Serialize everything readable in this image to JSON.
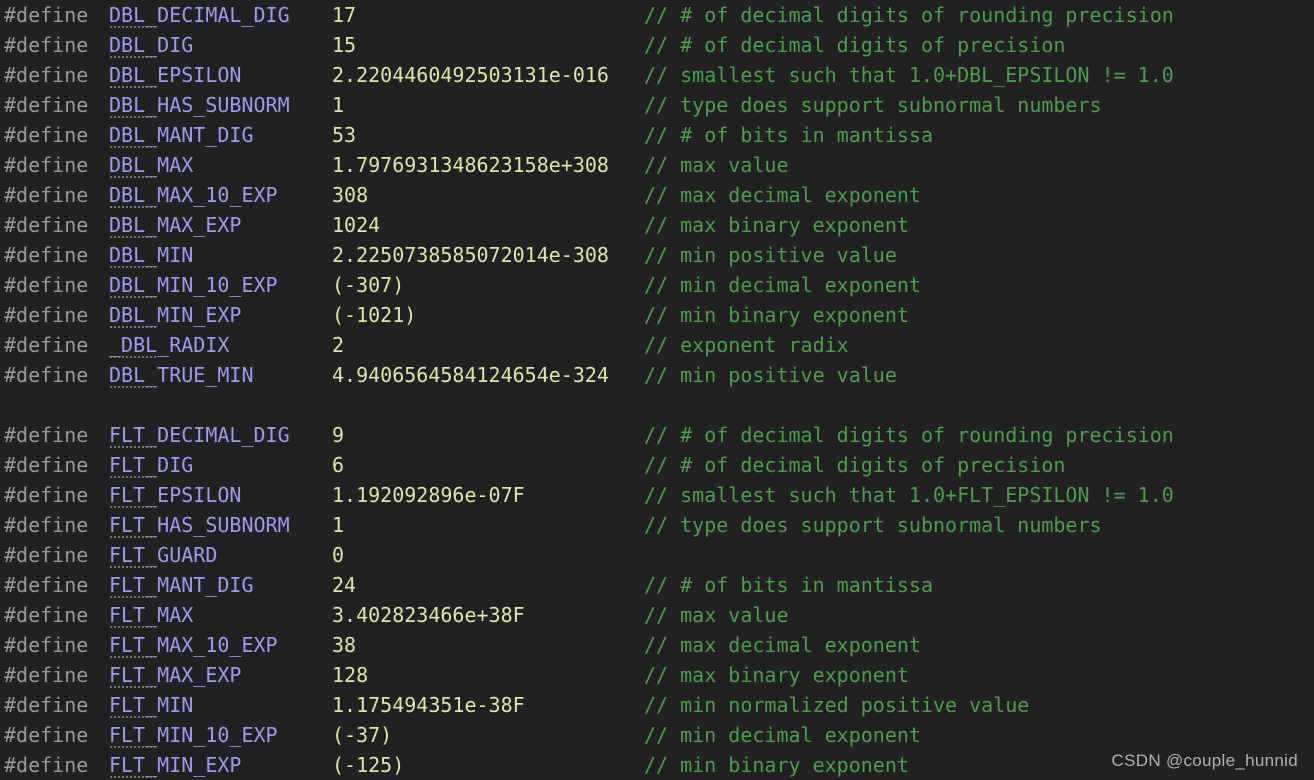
{
  "editor": {
    "background_color": "#212121",
    "keyword_color": "#9b9b95",
    "macro_name_color": "#9d9bee",
    "value_color": "#d9e8a9",
    "comment_color": "#4c9e4c",
    "define_keyword": "#define",
    "comment_prefix": "//",
    "hint_underline_chars": 4
  },
  "watermark": {
    "text": "CSDN @couple_hunnid"
  },
  "lines": [
    {
      "type": "define",
      "keyword": "#define",
      "name": "DBL_DECIMAL_DIG",
      "value": "17",
      "comment": "// # of decimal digits of rounding precision"
    },
    {
      "type": "define",
      "keyword": "#define",
      "name": "DBL_DIG",
      "value": "15",
      "comment": "// # of decimal digits of precision"
    },
    {
      "type": "define",
      "keyword": "#define",
      "name": "DBL_EPSILON",
      "value": "2.2204460492503131e-016",
      "comment": "// smallest such that 1.0+DBL_EPSILON != 1.0"
    },
    {
      "type": "define",
      "keyword": "#define",
      "name": "DBL_HAS_SUBNORM",
      "value": "1",
      "comment": "// type does support subnormal numbers"
    },
    {
      "type": "define",
      "keyword": "#define",
      "name": "DBL_MANT_DIG",
      "value": "53",
      "comment": "// # of bits in mantissa"
    },
    {
      "type": "define",
      "keyword": "#define",
      "name": "DBL_MAX",
      "value": "1.7976931348623158e+308",
      "comment": "// max value"
    },
    {
      "type": "define",
      "keyword": "#define",
      "name": "DBL_MAX_10_EXP",
      "value": "308",
      "comment": "// max decimal exponent"
    },
    {
      "type": "define",
      "keyword": "#define",
      "name": "DBL_MAX_EXP",
      "value": "1024",
      "comment": "// max binary exponent"
    },
    {
      "type": "define",
      "keyword": "#define",
      "name": "DBL_MIN",
      "value": "2.2250738585072014e-308",
      "comment": "// min positive value"
    },
    {
      "type": "define",
      "keyword": "#define",
      "name": "DBL_MIN_10_EXP",
      "value": "(-307)",
      "comment": "// min decimal exponent"
    },
    {
      "type": "define",
      "keyword": "#define",
      "name": "DBL_MIN_EXP",
      "value": "(-1021)",
      "comment": "// min binary exponent"
    },
    {
      "type": "define",
      "keyword": "#define",
      "name": "_DBL_RADIX",
      "value": "2",
      "comment": "// exponent radix"
    },
    {
      "type": "define",
      "keyword": "#define",
      "name": "DBL_TRUE_MIN",
      "value": "4.9406564584124654e-324",
      "comment": "// min positive value"
    },
    {
      "type": "blank"
    },
    {
      "type": "define",
      "keyword": "#define",
      "name": "FLT_DECIMAL_DIG",
      "value": "9",
      "comment": "// # of decimal digits of rounding precision"
    },
    {
      "type": "define",
      "keyword": "#define",
      "name": "FLT_DIG",
      "value": "6",
      "comment": "// # of decimal digits of precision"
    },
    {
      "type": "define",
      "keyword": "#define",
      "name": "FLT_EPSILON",
      "value": "1.192092896e-07F",
      "comment": "// smallest such that 1.0+FLT_EPSILON != 1.0"
    },
    {
      "type": "define",
      "keyword": "#define",
      "name": "FLT_HAS_SUBNORM",
      "value": "1",
      "comment": "// type does support subnormal numbers"
    },
    {
      "type": "define",
      "keyword": "#define",
      "name": "FLT_GUARD",
      "value": "0",
      "comment": ""
    },
    {
      "type": "define",
      "keyword": "#define",
      "name": "FLT_MANT_DIG",
      "value": "24",
      "comment": "// # of bits in mantissa"
    },
    {
      "type": "define",
      "keyword": "#define",
      "name": "FLT_MAX",
      "value": "3.402823466e+38F",
      "comment": "// max value"
    },
    {
      "type": "define",
      "keyword": "#define",
      "name": "FLT_MAX_10_EXP",
      "value": "38",
      "comment": "// max decimal exponent"
    },
    {
      "type": "define",
      "keyword": "#define",
      "name": "FLT_MAX_EXP",
      "value": "128",
      "comment": "// max binary exponent"
    },
    {
      "type": "define",
      "keyword": "#define",
      "name": "FLT_MIN",
      "value": "1.175494351e-38F",
      "comment": "// min normalized positive value"
    },
    {
      "type": "define",
      "keyword": "#define",
      "name": "FLT_MIN_10_EXP",
      "value": "(-37)",
      "comment": "// min decimal exponent"
    },
    {
      "type": "define",
      "keyword": "#define",
      "name": "FLT_MIN_EXP",
      "value": "(-125)",
      "comment": "// min binary exponent"
    }
  ]
}
